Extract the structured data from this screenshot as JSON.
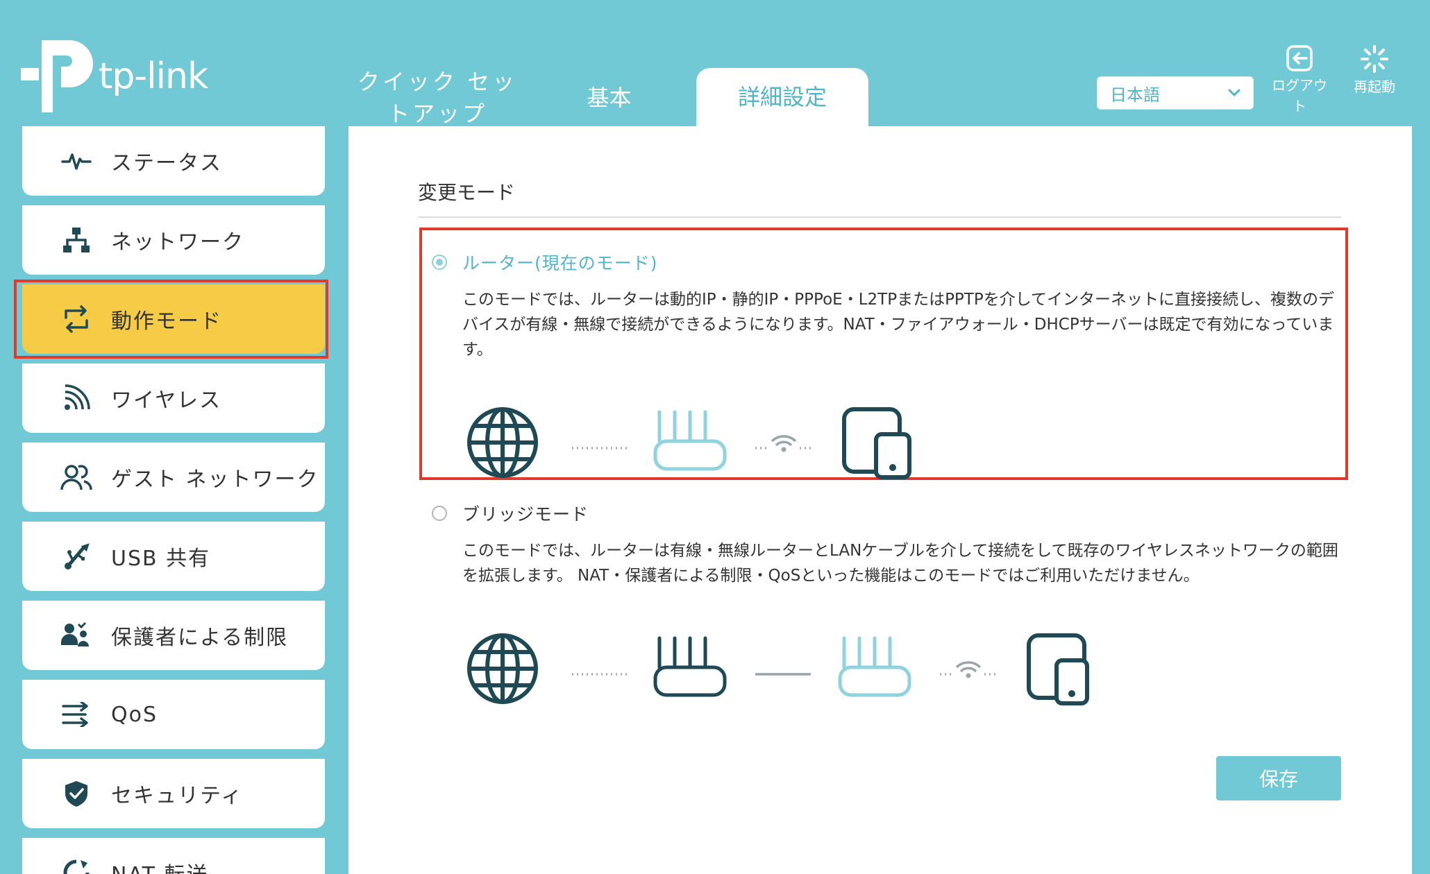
{
  "brand": {
    "name": "tp-link"
  },
  "tabs": [
    {
      "label": "クイック セットアップ"
    },
    {
      "label": "基本"
    },
    {
      "label": "詳細設定",
      "active": true
    }
  ],
  "language": {
    "selected": "日本語"
  },
  "header_actions": {
    "logout": "ログアウト",
    "reboot": "再起動"
  },
  "sidebar": {
    "items": [
      {
        "label": "ステータス",
        "icon": "pulse-icon"
      },
      {
        "label": "ネットワーク",
        "icon": "network-icon"
      },
      {
        "label": "動作モード",
        "icon": "mode-switch-icon",
        "active": true
      },
      {
        "label": "ワイヤレス",
        "icon": "wireless-icon"
      },
      {
        "label": "ゲスト ネットワーク",
        "icon": "guest-icon"
      },
      {
        "label": "USB 共有",
        "icon": "usb-icon"
      },
      {
        "label": "保護者による制限",
        "icon": "parental-icon"
      },
      {
        "label": "QoS",
        "icon": "qos-icon"
      },
      {
        "label": "セキュリティ",
        "icon": "shield-icon"
      },
      {
        "label": "NAT 転送",
        "icon": "nat-icon"
      }
    ]
  },
  "main": {
    "section_title": "変更モード",
    "modes": [
      {
        "label": "ルーター(現在のモード)",
        "selected": true,
        "description": "このモードでは、ルーターは動的IP・静的IP・PPPoE・L2TPまたはPPTPを介してインターネットに直接接続し、複数のデバイスが有線・無線で接続ができるようになります。NAT・ファイアウォール・DHCPサーバーは既定で有効になっています。"
      },
      {
        "label": "ブリッジモード",
        "selected": false,
        "description": "このモードでは、ルーターは有線・無線ルーターとLANケーブルを介して接続をして既存のワイヤレスネットワークの範囲を拡張します。 NAT・保護者による制限・QoSといった機能はこのモードではご利用いただけません。"
      }
    ],
    "save_label": "保存"
  },
  "colors": {
    "background": "#72c9d6",
    "accent": "#4fb6c6",
    "active_item": "#f6cb45",
    "highlight_border": "#e03a2e",
    "icon_dark": "#1f4a55"
  }
}
